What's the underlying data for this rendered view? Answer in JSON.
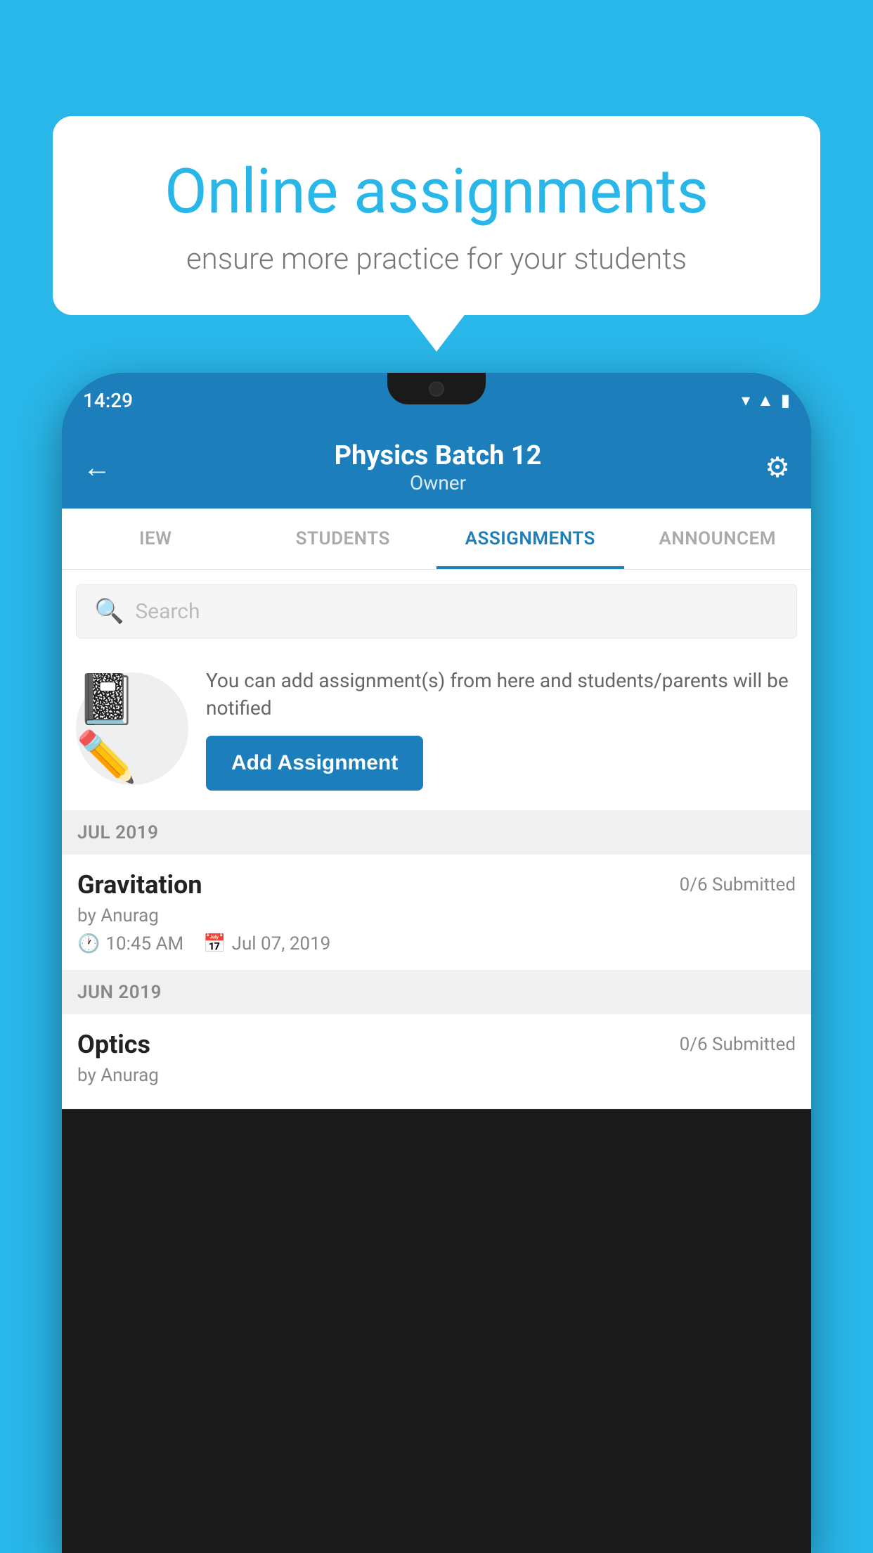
{
  "background_color": "#29b6e8",
  "speech_bubble": {
    "title": "Online assignments",
    "subtitle": "ensure more practice for your students"
  },
  "phone": {
    "status_bar": {
      "time": "14:29",
      "icons": [
        "wifi",
        "signal",
        "battery"
      ]
    },
    "header": {
      "title": "Physics Batch 12",
      "subtitle": "Owner",
      "back_label": "←",
      "gear_label": "⚙"
    },
    "tabs": [
      {
        "label": "IEW",
        "active": false
      },
      {
        "label": "STUDENTS",
        "active": false
      },
      {
        "label": "ASSIGNMENTS",
        "active": true
      },
      {
        "label": "ANNOUNCEM",
        "active": false
      }
    ],
    "search": {
      "placeholder": "Search"
    },
    "promo": {
      "description": "You can add assignment(s) from here and students/parents will be notified",
      "button_label": "Add Assignment"
    },
    "sections": [
      {
        "header": "JUL 2019",
        "assignments": [
          {
            "name": "Gravitation",
            "submitted": "0/6 Submitted",
            "author": "by Anurag",
            "time": "10:45 AM",
            "date": "Jul 07, 2019"
          }
        ]
      },
      {
        "header": "JUN 2019",
        "assignments": [
          {
            "name": "Optics",
            "submitted": "0/6 Submitted",
            "author": "by Anurag",
            "time": "",
            "date": ""
          }
        ]
      }
    ]
  }
}
